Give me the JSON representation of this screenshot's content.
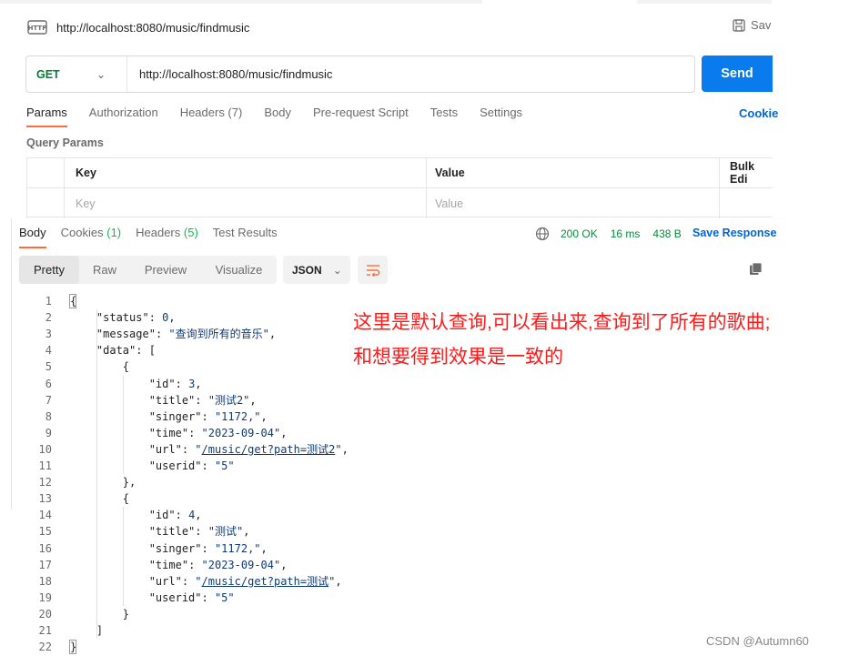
{
  "request": {
    "title": "http://localhost:8080/music/findmusic",
    "save_label": "Sav",
    "method": "GET",
    "url": "http://localhost:8080/music/findmusic",
    "send_label": "Send",
    "tabs": [
      {
        "label": "Params"
      },
      {
        "label": "Authorization"
      },
      {
        "label": "Headers (7)"
      },
      {
        "label": "Body"
      },
      {
        "label": "Pre-request Script"
      },
      {
        "label": "Tests"
      },
      {
        "label": "Settings"
      }
    ],
    "cookies_label": "Cookie",
    "query_params_title": "Query Params",
    "table": {
      "key_header": "Key",
      "value_header": "Value",
      "bulk_edit": "Bulk Edi",
      "key_placeholder": "Key",
      "value_placeholder": "Value"
    }
  },
  "response": {
    "tabs": {
      "body": "Body",
      "cookies": "Cookies",
      "cookies_count": "(1)",
      "headers": "Headers",
      "headers_count": "(5)",
      "test_results": "Test Results"
    },
    "status": "200 OK",
    "time": "16 ms",
    "size": "438 B",
    "save_response": "Save Response",
    "views": [
      "Pretty",
      "Raw",
      "Preview",
      "Visualize"
    ],
    "format": "JSON",
    "code_lines": [
      "{",
      "    \"status\": 0,",
      "    \"message\": \"查询到所有的音乐\",",
      "    \"data\": [",
      "        {",
      "            \"id\": 3,",
      "            \"title\": \"测试2\",",
      "            \"singer\": \"1172,\",",
      "            \"time\": \"2023-09-04\",",
      "            \"url\": \"/music/get?path=测试2\",",
      "            \"userid\": \"5\"",
      "        },",
      "        {",
      "            \"id\": 4,",
      "            \"title\": \"测试\",",
      "            \"singer\": \"1172,\",",
      "            \"time\": \"2023-09-04\",",
      "            \"url\": \"/music/get?path=测试\",",
      "            \"userid\": \"5\"",
      "        }",
      "    ]",
      "}"
    ]
  },
  "annotation": {
    "line1": "这里是默认查询,可以看出来,查询到了所有的歌曲;",
    "line2": "和想要得到效果是一致的"
  },
  "watermark": "CSDN @Autumn60"
}
